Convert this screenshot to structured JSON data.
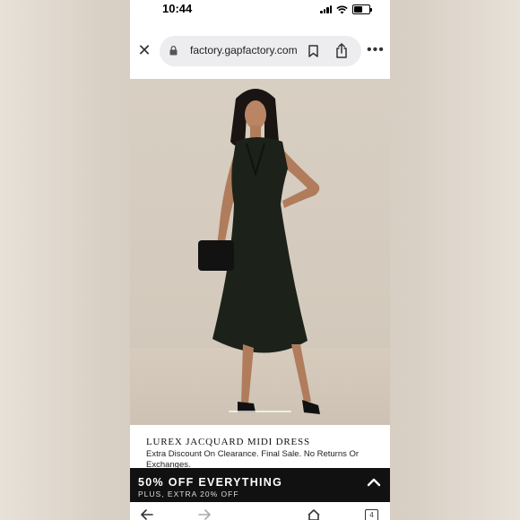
{
  "status_bar": {
    "time": "10:44"
  },
  "browser": {
    "url": "factory.gapfactory.com",
    "tab_count": "4"
  },
  "product": {
    "title": "LUREX JACQUARD MIDI DRESS",
    "note": "Extra Discount On Clearance. Final Sale. No Returns Or Exchanges."
  },
  "promo": {
    "title": "50% OFF EVERYTHING",
    "subtitle": "PLUS, EXTRA 20% OFF"
  },
  "colors": {
    "dress": "#1c2219",
    "banner": "#111111",
    "backdrop": "#d8cfc3"
  },
  "icons": [
    "close-icon",
    "lock-icon",
    "bookmark-icon",
    "share-icon",
    "more-icon",
    "chevron-up-icon",
    "back-arrow-icon",
    "forward-arrow-icon",
    "home-icon",
    "tabs-icon"
  ]
}
